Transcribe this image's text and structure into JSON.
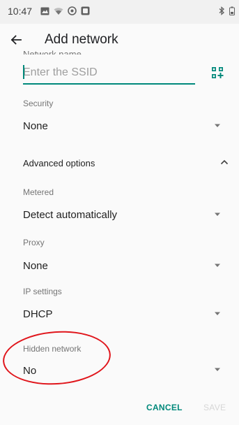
{
  "status_bar": {
    "time": "10:47"
  },
  "app_bar": {
    "title": "Add network"
  },
  "network_name": {
    "label": "Network name",
    "placeholder": "Enter the SSID"
  },
  "fields": [
    {
      "label": "Security",
      "value": "None"
    },
    {
      "label": "Metered",
      "value": "Detect automatically"
    },
    {
      "label": "Proxy",
      "value": "None"
    },
    {
      "label": "IP settings",
      "value": "DHCP"
    },
    {
      "label": "Hidden network",
      "value": "No"
    }
  ],
  "advanced_options": {
    "label": "Advanced options",
    "expanded": true
  },
  "actions": {
    "cancel_label": "CANCEL",
    "save_label": "SAVE"
  },
  "colors": {
    "accent": "#00897b",
    "annotation_circle": "#e0151b",
    "disabled": "#d6d6d6"
  }
}
